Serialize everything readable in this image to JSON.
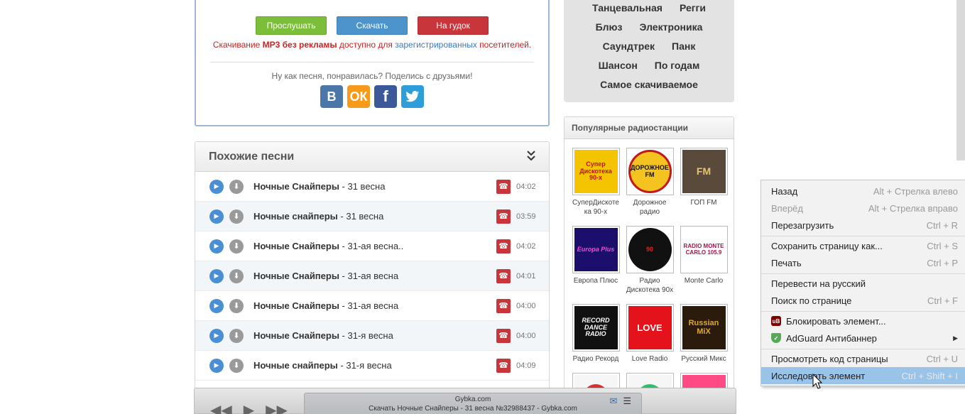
{
  "download": {
    "listen_label": "Прослушать",
    "download_label": "Скачать",
    "ringtone_label": "На гудок",
    "note_pre": "Скачивание ",
    "note_bold": "MP3 без рекламы",
    "note_mid": " доступно для ",
    "note_link": "зарегистрированных",
    "note_post": " посетителей.",
    "share_text": "Ну как песня, понравилась? Поделись с друзьями!",
    "social": [
      "vk",
      "odnoklassniki",
      "facebook",
      "twitter"
    ]
  },
  "similar": {
    "title": "Похожие песни",
    "songs": [
      {
        "artist": "Ночные Снайперы",
        "title": " - 31 весна",
        "duration": "04:02"
      },
      {
        "artist": "Ночные снайперы",
        "title": " - 31 весна",
        "duration": "03:59"
      },
      {
        "artist": "Ночные Снайперы",
        "title": " - 31-ая весна..",
        "duration": "04:02"
      },
      {
        "artist": "Ночные Снайперы",
        "title": " - 31-ая весна",
        "duration": "04:01"
      },
      {
        "artist": "Ночные Снайперы",
        "title": " - 31-ая весна",
        "duration": "04:00"
      },
      {
        "artist": "Ночные Снайперы",
        "title": " - 31-я весна",
        "duration": "04:00"
      },
      {
        "artist": "Ночные снайперы",
        "title": " - 31-я весна",
        "duration": "04:09"
      }
    ]
  },
  "genres": {
    "rows": [
      [
        "Танцевальная",
        "Регги"
      ],
      [
        "Блюз",
        "Электроника"
      ],
      [
        "Саундтрек",
        "Панк"
      ],
      [
        "Шансон",
        "По годам"
      ],
      [
        "Самое скачиваемое"
      ]
    ]
  },
  "radio": {
    "title": "Популярные радиостанции",
    "stations": [
      {
        "name": "СуперДискоте ка 90-х",
        "logo_text": "Супер Дискотека 90-х"
      },
      {
        "name": "Дорожное радио",
        "logo_text": "ДОРОЖНОЕ FM"
      },
      {
        "name": "ГОП FM",
        "logo_text": "FM"
      },
      {
        "name": "Европа Плюс",
        "logo_text": "Europa Plus"
      },
      {
        "name": "Радио Дискотека 90х",
        "logo_text": "90"
      },
      {
        "name": "Monte Carlo",
        "logo_text": "RADIO MONTE CARLO 105.9"
      },
      {
        "name": "Радио Рекорд",
        "logo_text": "RECORD DANCE RADIO"
      },
      {
        "name": "Love Radio",
        "logo_text": "LOVE"
      },
      {
        "name": "Русский Микс",
        "logo_text": "Russian MiX"
      }
    ]
  },
  "player": {
    "site": "Gybka.com",
    "track": "Скачать Ночные Снайперы - 31 весна №32988437 - Gybka.com"
  },
  "context_menu": {
    "items": [
      {
        "label": "Назад",
        "shortcut": "Alt + Стрелка влево"
      },
      {
        "label": "Вперёд",
        "shortcut": "Alt + Стрелка вправо"
      },
      {
        "label": "Перезагрузить",
        "shortcut": "Ctrl + R"
      },
      {
        "label": "Сохранить страницу как...",
        "shortcut": "Ctrl + S"
      },
      {
        "label": "Печать",
        "shortcut": "Ctrl + P"
      },
      {
        "label": "Перевести на русский",
        "shortcut": ""
      },
      {
        "label": "Поиск по странице",
        "shortcut": "Ctrl + F"
      },
      {
        "label": "Блокировать элемент...",
        "shortcut": ""
      },
      {
        "label": "AdGuard Антибаннер",
        "shortcut": ""
      },
      {
        "label": "Просмотреть код страницы",
        "shortcut": "Ctrl + U"
      },
      {
        "label": "Исследовать элемент",
        "shortcut": "Ctrl + Shift + I"
      }
    ]
  },
  "colors": {
    "green_button": "#7cbd3a",
    "blue_button": "#4d94cc",
    "red_button": "#c8363b",
    "menu_highlight": "#9ac3e8"
  }
}
